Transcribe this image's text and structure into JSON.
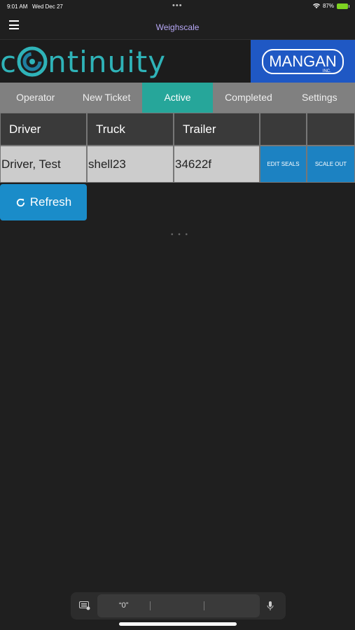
{
  "status": {
    "time": "9:01 AM",
    "date": "Wed Dec 27",
    "battery": "87%"
  },
  "app": {
    "title": "Weighscale"
  },
  "brand": {
    "logo_text": "ntinuity",
    "logo_prefix": "c",
    "partner": "MANGAN",
    "partner_suffix": "INC."
  },
  "tabs": [
    {
      "label": "Operator",
      "active": false
    },
    {
      "label": "New Ticket",
      "active": false
    },
    {
      "label": "Active",
      "active": true
    },
    {
      "label": "Completed",
      "active": false
    },
    {
      "label": "Settings",
      "active": false
    }
  ],
  "table": {
    "headers": [
      "Driver",
      "Truck",
      "Trailer",
      "",
      ""
    ],
    "rows": [
      {
        "driver": "Driver, Test",
        "truck": "shell23",
        "trailer": "34622f",
        "action1": "EDIT SEALS",
        "action2": "SCALE OUT"
      }
    ]
  },
  "refresh_label": "Refresh",
  "keyboard": {
    "suggestion": "“0”"
  },
  "colors": {
    "accent": "#26a69a",
    "button": "#1a8cc9",
    "brand": "#1f58c4",
    "title": "#b6a7f5"
  }
}
